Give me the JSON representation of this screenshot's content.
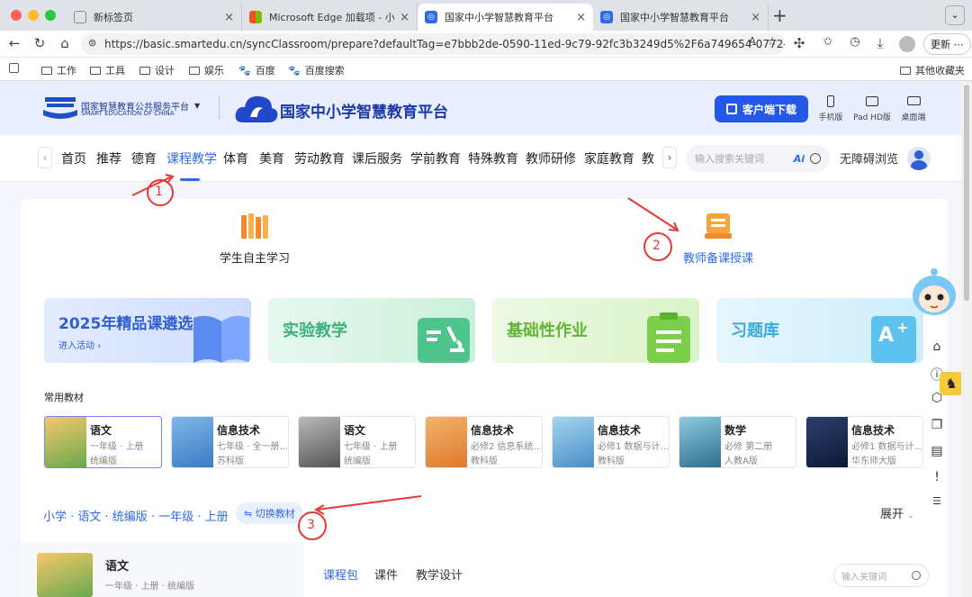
{
  "browser": {
    "tabs": [
      {
        "title": "新标签页",
        "close": "×"
      },
      {
        "title": "Microsoft Edge 加载项 - 小源教材…",
        "close": "×"
      },
      {
        "title": "国家中小学智慧教育平台",
        "close": "×"
      },
      {
        "title": "国家中小学智慧教育平台",
        "close": "×"
      }
    ],
    "new_tab": "+",
    "url": "https://basic.smartedu.cn/syncClassroom/prepare?defaultTag=e7bbb2de-0590-11ed-9c79-92fc3b3249d5%2F6a749654-0772-1...",
    "update_button": "更新",
    "bookmarks": [
      "工作",
      "工具",
      "设计",
      "娱乐",
      "百度",
      "百度搜索"
    ],
    "other_bookmarks": "其他收藏夹"
  },
  "site": {
    "org_name": "国家智慧教育公共服务平台",
    "org_name_en": "SMART EDUCATION OF CHINA",
    "platform_name": "国家中小学智慧教育平台",
    "download_button": "客户端下载",
    "devices": [
      "手机版",
      "Pad HD版",
      "桌面端"
    ],
    "nav": [
      "首页",
      "推荐",
      "德育",
      "课程教学",
      "体育",
      "美育",
      "劳动教育",
      "课后服务",
      "学前教育",
      "特殊教育",
      "教师研修",
      "家庭教育",
      "教"
    ],
    "active_nav": "课程教学",
    "search_placeholder": "输入搜索关键词",
    "ai_label": "Ai",
    "accessibility": "无障碍浏览",
    "modes": {
      "student": "学生自主学习",
      "teacher": "教师备课授课"
    },
    "banners": {
      "b1_title": "2025年精品课遴选",
      "b1_link": "进入活动",
      "b2_title": "实验教学",
      "b3_title": "基础性作业",
      "b4_title": "习题库"
    },
    "common_title": "常用教材",
    "books": [
      {
        "name": "语文",
        "sub": "一年级 · 上册",
        "pub": "统编版"
      },
      {
        "name": "信息技术",
        "sub": "七年级 · 全一册…",
        "pub": "苏科版"
      },
      {
        "name": "语文",
        "sub": "七年级 · 上册",
        "pub": "统编版"
      },
      {
        "name": "信息技术",
        "sub": "必修2 信息系统…",
        "pub": "教科版"
      },
      {
        "name": "信息技术",
        "sub": "必修1 数据与计…",
        "pub": "教科版"
      },
      {
        "name": "数学",
        "sub": "必修 第二册",
        "pub": "人教A版"
      },
      {
        "name": "信息技术",
        "sub": "必修1 数据与计…",
        "pub": "华东师大版"
      }
    ],
    "breadcrumb": "小学 · 语文 · 统编版 · 一年级 · 上册",
    "switch_button": "⇋ 切换教材",
    "expand": "展开",
    "current_book": {
      "name": "语文",
      "sub": "一年级 · 上册 · 统编版"
    },
    "content_tabs": [
      "课程包",
      "课件",
      "教学设计"
    ],
    "content_search_placeholder": "输入关键词"
  },
  "annotations": [
    "1",
    "2",
    "3"
  ],
  "colors": {
    "accent": "#2f6be8",
    "annotation": "#e53935"
  }
}
